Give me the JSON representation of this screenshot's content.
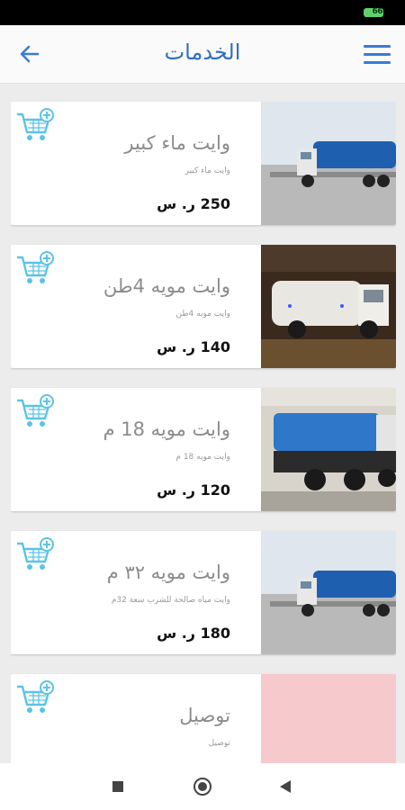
{
  "status": {
    "battery": "66"
  },
  "header": {
    "title": "الخدمات",
    "menu_icon": "hamburger-menu-icon",
    "back_icon": "arrow-left-icon"
  },
  "items": [
    {
      "title": "وايت ماء كبير",
      "subtitle": "وايت ماء كبير",
      "price": "250 ر. س",
      "image": "blue-water-tanker-truck"
    },
    {
      "title": "وايت مويه 4طن",
      "subtitle": "وايت مويه 4طن",
      "price": "140 ر. س",
      "image": "white-tanker-truck-night"
    },
    {
      "title": "وايت مويه 18 م",
      "subtitle": "وايت مويه 18 م",
      "price": "120 ر. س",
      "image": "blue-tanker-drinking-water"
    },
    {
      "title": "وايت مويه ٣٢ م",
      "subtitle": "وايت مياه صالحة للشرب سعة 32م",
      "price": "180 ر. س",
      "image": "blue-water-tanker-truck"
    },
    {
      "title": "توصيل",
      "subtitle": "توصيل",
      "price": "",
      "image": "pink-placeholder"
    }
  ],
  "colors": {
    "accent": "#2f6fc4",
    "cart": "#5bc3e8"
  }
}
